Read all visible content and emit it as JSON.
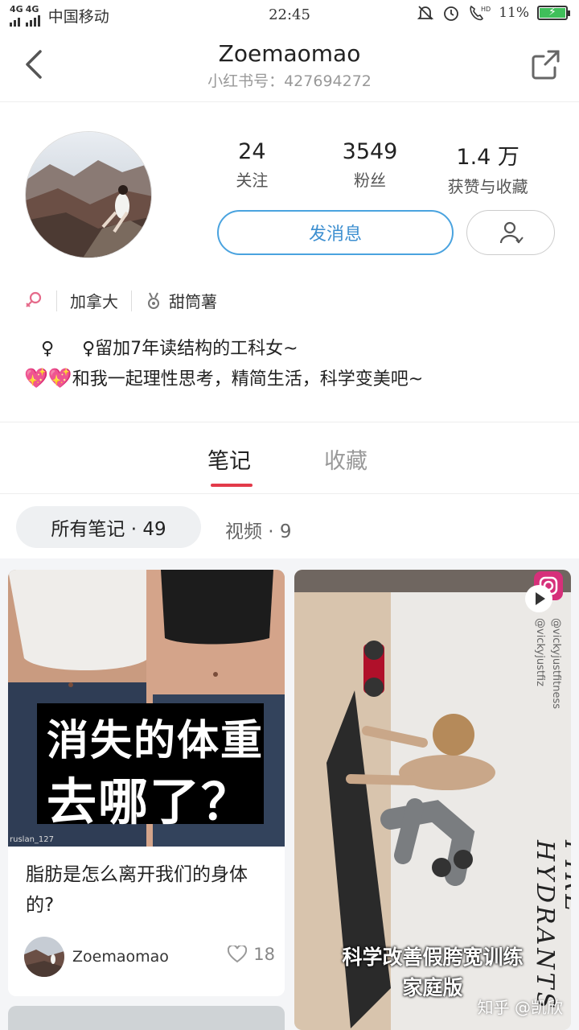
{
  "status_bar": {
    "signal_1": "4G",
    "signal_2": "4G",
    "carrier": "中国移动",
    "time": "22:45",
    "battery": "11%"
  },
  "header": {
    "title": "Zoemaomao",
    "subtitle": "小红书号：427694272"
  },
  "profile": {
    "stats": [
      {
        "value": "24",
        "label": "关注"
      },
      {
        "value": "3549",
        "label": "粉丝"
      },
      {
        "value": "1.4 万",
        "label": "获赞与收藏"
      }
    ],
    "message_button": "发消息",
    "location": "加拿大",
    "badge": "甜筒薯",
    "bio_line1": "   ♀     ♀留加7年读结构的工科女~",
    "bio_line2": "和我一起理性思考，精简生活，科学变美吧~"
  },
  "tabs": {
    "notes": "笔记",
    "favorites": "收藏"
  },
  "filter": {
    "all_notes": "所有笔记 · 49",
    "videos": "视频 · 9"
  },
  "feed": {
    "card1": {
      "image_caption_line1": "消失的体重",
      "image_caption_line2": "去哪了？",
      "image_credit": "ruslan_127",
      "title": "脂肪是怎么离开我们的身体的?",
      "author": "Zoemaomao",
      "likes": "18"
    },
    "card2": {
      "handle1": "@vickyjustfiz",
      "handle2": "@vickyjustfitness",
      "side_text": "FIRE HYDRANTS",
      "caption_line1": "科学改善假胯宽训练",
      "caption_line2": "家庭版"
    }
  },
  "watermark": "知乎 @凯欣",
  "colors": {
    "accent_red": "#e33a4a",
    "accent_blue": "#3d8fd0"
  }
}
